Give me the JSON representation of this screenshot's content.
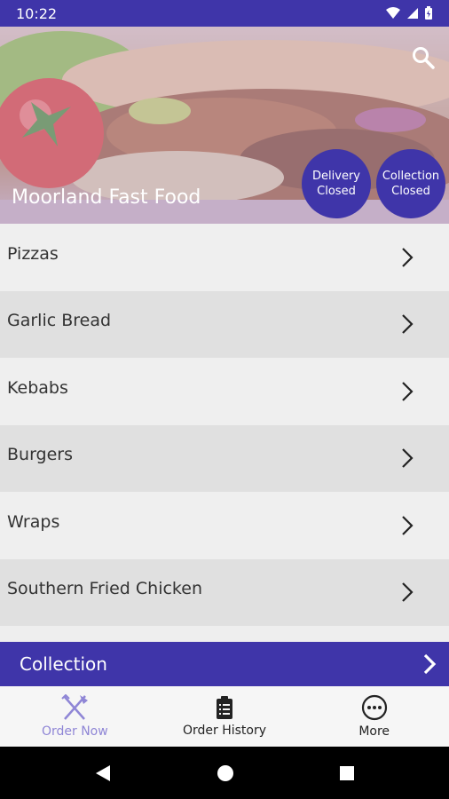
{
  "status_bar": {
    "time": "10:22"
  },
  "header": {
    "restaurant_name": "Moorland Fast Food",
    "delivery_status": {
      "line1": "Delivery",
      "line2": "Closed"
    },
    "collection_status": {
      "line1": "Collection",
      "line2": "Closed"
    }
  },
  "menu": {
    "categories": [
      {
        "label": "Pizzas"
      },
      {
        "label": "Garlic Bread"
      },
      {
        "label": "Kebabs"
      },
      {
        "label": "Burgers"
      },
      {
        "label": "Wraps"
      },
      {
        "label": "Southern Fried Chicken"
      }
    ]
  },
  "order_mode": {
    "label": "Collection"
  },
  "bottom_nav": {
    "items": [
      {
        "label": "Order Now",
        "icon": "fork-knife-icon",
        "active": true
      },
      {
        "label": "Order History",
        "icon": "clipboard-icon",
        "active": false
      },
      {
        "label": "More",
        "icon": "more-icon",
        "active": false
      }
    ]
  },
  "colors": {
    "brand": "#3f35a9",
    "active_nav": "#8f86d6",
    "row_light": "#efefef",
    "row_dark": "#e0e0e0"
  }
}
